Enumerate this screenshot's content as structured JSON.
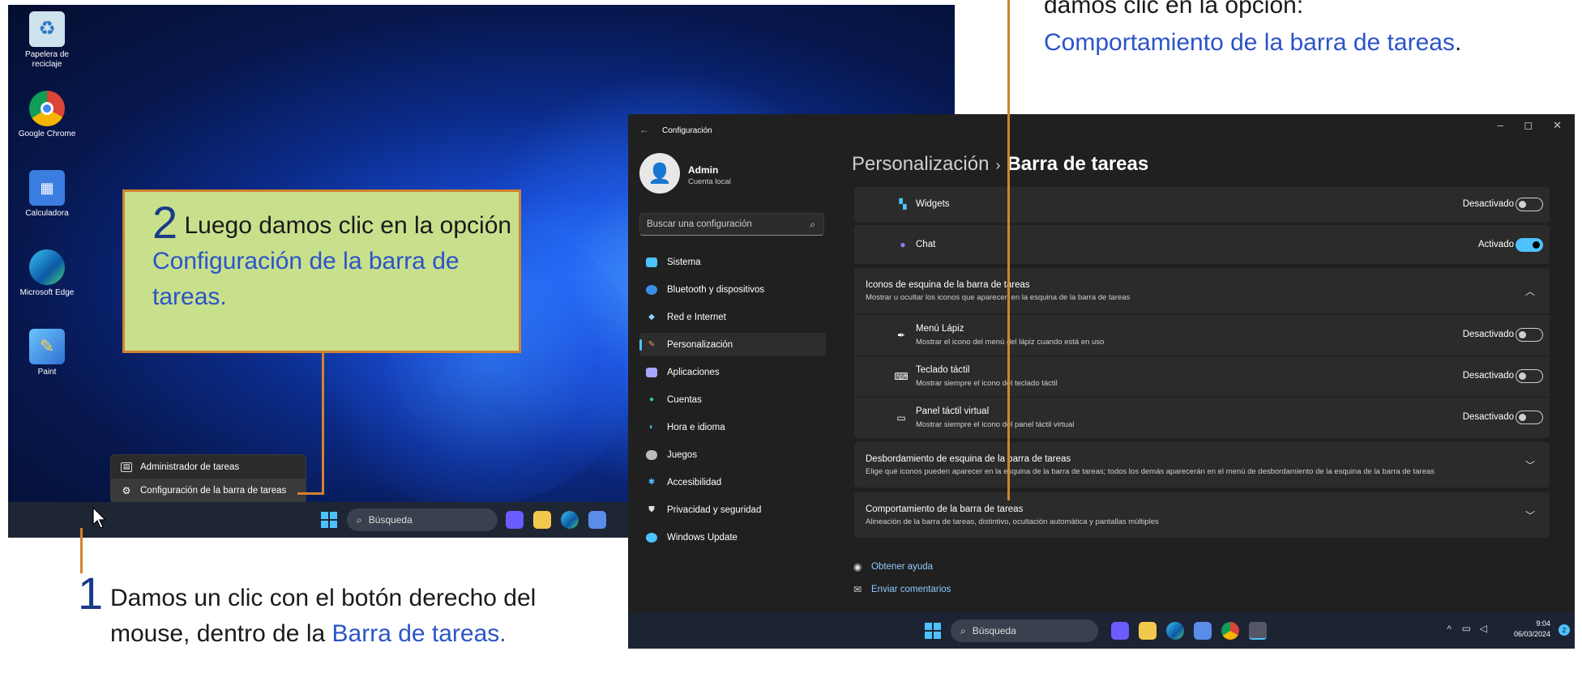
{
  "desktop": {
    "icons": [
      {
        "label_line1": "Papelera de",
        "label_line2": "reciclaje",
        "icon": "recycle-bin-icon"
      },
      {
        "label_line1": "Google Chrome",
        "label_line2": "",
        "icon": "chrome-icon"
      },
      {
        "label_line1": "Calculadora",
        "label_line2": "",
        "icon": "calculator-icon"
      },
      {
        "label_line1": "Microsoft Edge",
        "label_line2": "",
        "icon": "edge-icon"
      },
      {
        "label_line1": "Paint",
        "label_line2": "",
        "icon": "paint-icon"
      }
    ],
    "context_menu": [
      {
        "label": "Administrador de tareas",
        "icon": "task-manager-icon"
      },
      {
        "label": "Configuración de la barra de tareas",
        "icon": "gear-icon"
      }
    ],
    "taskbar_search": "Búsqueda"
  },
  "settings": {
    "window_title": "Configuración",
    "user": {
      "name": "Admin",
      "type": "Cuenta local"
    },
    "search_placeholder": "Buscar una configuración",
    "nav": [
      {
        "label": "Sistema",
        "color": "#4cc2ff"
      },
      {
        "label": "Bluetooth y dispositivos",
        "color": "#3b8eea"
      },
      {
        "label": "Red e Internet",
        "color": "#8fd3ff"
      },
      {
        "label": "Personalización",
        "color": "#f0a35e"
      },
      {
        "label": "Aplicaciones",
        "color": "#a6a6ff"
      },
      {
        "label": "Cuentas",
        "color": "#3ecf8e"
      },
      {
        "label": "Hora e idioma",
        "color": "#4cc2ff"
      },
      {
        "label": "Juegos",
        "color": "#bbbbbb"
      },
      {
        "label": "Accesibilidad",
        "color": "#4cc2ff"
      },
      {
        "label": "Privacidad y seguridad",
        "color": "#dddddd"
      },
      {
        "label": "Windows Update",
        "color": "#4cc2ff"
      }
    ],
    "breadcrumb": {
      "parent": "Personalización",
      "separator": "›",
      "current": "Barra de tareas"
    },
    "rows": {
      "widgets": {
        "title": "Widgets",
        "state": "Desactivado",
        "on": false
      },
      "chat": {
        "title": "Chat",
        "state": "Activado",
        "on": true
      },
      "corner_icons": {
        "title": "Iconos de esquina de la barra de tareas",
        "sub": "Mostrar u ocultar los iconos que aparecen en la esquina de la barra de tareas"
      },
      "pen_menu": {
        "title": "Menú Lápiz",
        "sub": "Mostrar el icono del menú del lápiz cuando está en uso",
        "state": "Desactivado"
      },
      "touch_keyboard": {
        "title": "Teclado táctil",
        "sub": "Mostrar siempre el icono del teclado táctil",
        "state": "Desactivado"
      },
      "touchpad": {
        "title": "Panel táctil virtual",
        "sub": "Mostrar siempre el icono del panel táctil virtual",
        "state": "Desactivado"
      },
      "overflow": {
        "title": "Desbordamiento de esquina de la barra de tareas",
        "sub": "Elige qué iconos pueden aparecer en la esquina de la barra de tareas; todos los demás aparecerán en el menú de desbordamiento de la esquina de la barra de tareas"
      },
      "behavior": {
        "title": "Comportamiento de la barra de tareas",
        "sub": "Alineación de la barra de tareas, distintivo, ocultación automática y pantallas múltiples"
      }
    },
    "links": {
      "help": "Obtener ayuda",
      "feedback": "Enviar comentarios"
    },
    "taskbar": {
      "search": "Búsqueda",
      "time": "9:04",
      "date": "06/03/2024",
      "badge": "2"
    }
  },
  "annotations": {
    "step2": {
      "num": "2",
      "text_a": " Luego damos clic en la opción ",
      "link": "Configuración de la barra de tareas."
    },
    "step1": {
      "num": "1",
      "text_a": "Damos un clic con el botón derecho del mouse, dentro de la ",
      "link": "Barra de tareas."
    },
    "step3": {
      "text_a": "damos clic en la opción:",
      "link": "Comportamiento de la barra de tareas",
      "tail": "."
    }
  },
  "colors": {
    "accent": "#4cc2ff",
    "annotation_orange": "#d2832f",
    "annotation_blue": "#2b54c8",
    "callout_bg": "#c8e08c"
  }
}
